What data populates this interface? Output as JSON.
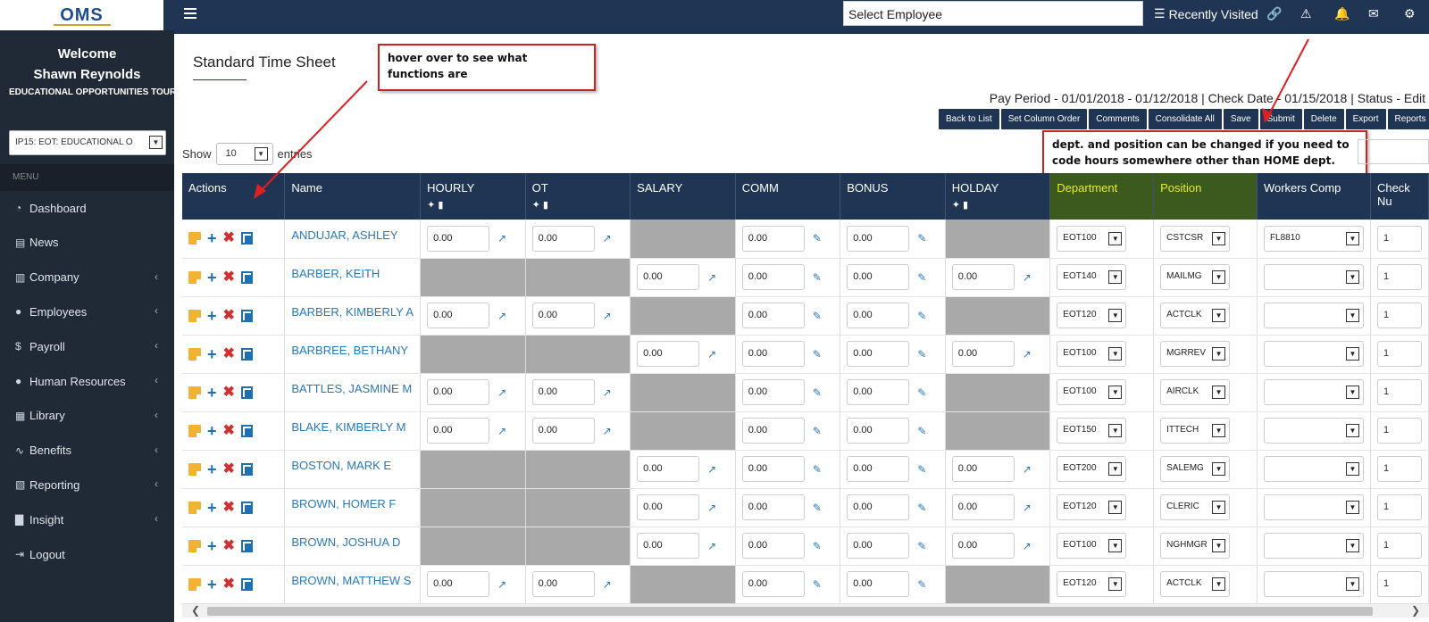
{
  "topbar": {
    "logo": "OMS",
    "select_employee": "Select Employee",
    "recently_visited": "Recently Visited"
  },
  "sidebar": {
    "welcome": "Welcome",
    "user": "Shawn Reynolds",
    "company": "EDUCATIONAL OPPORTUNITIES TOUR",
    "company_select": "IP15: EOT: EDUCATIONAL O",
    "menu_header": "MENU",
    "items": [
      {
        "label": "Dashboard",
        "icon": "dashboard-icon",
        "arrow": false
      },
      {
        "label": "News",
        "icon": "news-icon",
        "arrow": false
      },
      {
        "label": "Company",
        "icon": "building-icon",
        "arrow": true
      },
      {
        "label": "Employees",
        "icon": "user-icon",
        "arrow": true
      },
      {
        "label": "Payroll",
        "icon": "dollar-icon",
        "arrow": true
      },
      {
        "label": "Human Resources",
        "icon": "users-icon",
        "arrow": true
      },
      {
        "label": "Library",
        "icon": "book-icon",
        "arrow": true
      },
      {
        "label": "Benefits",
        "icon": "heartbeat-icon",
        "arrow": true
      },
      {
        "label": "Reporting",
        "icon": "report-icon",
        "arrow": true
      },
      {
        "label": "Insight",
        "icon": "chart-icon",
        "arrow": true
      },
      {
        "label": "Logout",
        "icon": "logout-icon",
        "arrow": false
      }
    ]
  },
  "main": {
    "title": "Standard Time Sheet",
    "callout_hover": "hover over to see what functions are",
    "callout_dept": "dept. and position can be changed if you need to code hours somewhere other than HOME dept.",
    "pay_period": "Pay Period - 01/01/2018 - 01/12/2018 | Check Date - 01/15/2018 | Status - Edit",
    "buttons": [
      "Back to List",
      "Set Column Order",
      "Comments",
      "Consolidate All",
      "Save",
      "Submit",
      "Delete",
      "Export",
      "Reports"
    ],
    "show_label": "Show",
    "entries_value": "10",
    "entries_label": "entries"
  },
  "table": {
    "headers": [
      "Actions",
      "Name",
      "HOURLY",
      "OT",
      "SALARY",
      "COMM",
      "BONUS",
      "HOLDAY",
      "Department",
      "Position",
      "Workers Comp",
      "Check Nu"
    ],
    "rows": [
      {
        "name": "ANDUJAR, ASHLEY",
        "type": "hourly",
        "dept": "EOT100",
        "pos": "CSTCSR",
        "wc": "FL8810"
      },
      {
        "name": "BARBER, KEITH",
        "type": "salary",
        "dept": "EOT140",
        "pos": "MAILMG",
        "wc": ""
      },
      {
        "name": "BARBER, KIMBERLY A",
        "type": "hourly",
        "dept": "EOT120",
        "pos": "ACTCLK",
        "wc": ""
      },
      {
        "name": "BARBREE, BETHANY",
        "type": "salary",
        "dept": "EOT100",
        "pos": "MGRREV",
        "wc": ""
      },
      {
        "name": "BATTLES, JASMINE M",
        "type": "hourly",
        "dept": "EOT100",
        "pos": "AIRCLK",
        "wc": ""
      },
      {
        "name": "BLAKE, KIMBERLY M",
        "type": "hourly",
        "dept": "EOT150",
        "pos": "ITTECH",
        "wc": ""
      },
      {
        "name": "BOSTON, MARK E",
        "type": "salary",
        "dept": "EOT200",
        "pos": "SALEMG",
        "wc": ""
      },
      {
        "name": "BROWN, HOMER F",
        "type": "salary",
        "dept": "EOT120",
        "pos": "CLERIC",
        "wc": ""
      },
      {
        "name": "BROWN, JOSHUA D",
        "type": "salary",
        "dept": "EOT100",
        "pos": "NGHMGR",
        "wc": ""
      },
      {
        "name": "BROWN, MATTHEW S",
        "type": "hourly",
        "dept": "EOT120",
        "pos": "ACTCLK",
        "wc": ""
      }
    ],
    "amount": "0.00",
    "check": "1"
  }
}
